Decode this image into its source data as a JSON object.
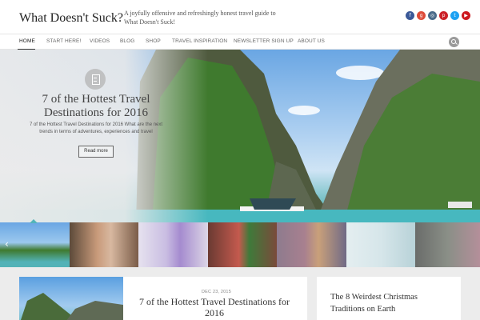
{
  "site": {
    "title": "What Doesn't Suck?",
    "tagline": "A joyfully offensive and refreshingly honest travel guide to What Doesn't Suck!"
  },
  "social": [
    {
      "icon": "facebook-icon",
      "glyph": "f",
      "color": "#3b5998"
    },
    {
      "icon": "google-plus-icon",
      "glyph": "g",
      "color": "#dd4b39"
    },
    {
      "icon": "instagram-icon",
      "glyph": "◎",
      "color": "#4a6b8a"
    },
    {
      "icon": "pinterest-icon",
      "glyph": "p",
      "color": "#cb2027"
    },
    {
      "icon": "twitter-icon",
      "glyph": "t",
      "color": "#1da1f2"
    },
    {
      "icon": "youtube-icon",
      "glyph": "▶",
      "color": "#cc181e"
    }
  ],
  "nav": {
    "items": [
      "HOME",
      "START HERE!",
      "VIDEOS",
      "BLOG",
      "SHOP",
      "TRAVEL INSPIRATION",
      "NEWSLETTER SIGN UP",
      "ABOUT US"
    ],
    "active": "HOME"
  },
  "hero": {
    "title": "7 of the Hottest Travel Destinations for 2016",
    "excerpt": "7 of the Hottest Travel Destinations for 2016 What are the next trends in terms of adventures, experiences and travel",
    "button": "Read more"
  },
  "featured": {
    "date": "DEC 23, 2015",
    "title": "7 of the Hottest Travel Destinations for 2016"
  },
  "sidebar": {
    "post_title": "The 8 Weirdest Christmas Traditions on Earth"
  },
  "colors": {
    "accent": "#53b4ba",
    "nav_text": "#666666",
    "lower_bg": "#ececec"
  }
}
